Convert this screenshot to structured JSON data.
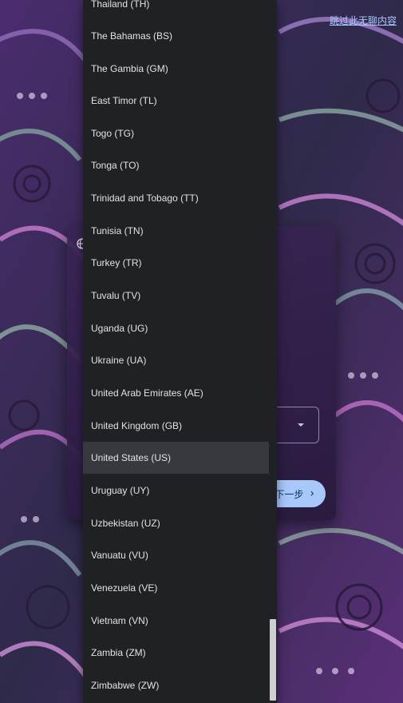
{
  "page": {
    "skip_link": "跳过此无聊内容"
  },
  "dialog": {
    "next_button_label": "下一步",
    "next_chevron": "›"
  },
  "dropdown": {
    "selected_value": "United States (US)",
    "options": [
      "Thailand (TH)",
      "The Bahamas (BS)",
      "The Gambia (GM)",
      "East Timor (TL)",
      "Togo (TG)",
      "Tonga (TO)",
      "Trinidad and Tobago (TT)",
      "Tunisia (TN)",
      "Turkey (TR)",
      "Tuvalu (TV)",
      "Uganda (UG)",
      "Ukraine (UA)",
      "United Arab Emirates (AE)",
      "United Kingdom (GB)",
      "United States (US)",
      "Uruguay (UY)",
      "Uzbekistan (UZ)",
      "Vanuatu (VU)",
      "Venezuela (VE)",
      "Vietnam (VN)",
      "Zambia (ZM)",
      "Zimbabwe (ZW)"
    ]
  },
  "colors": {
    "dropdown_bg": "#1f2125",
    "selected_bg": "#37393e",
    "accent": "#a8c7fa",
    "link": "#a9c7ff"
  }
}
